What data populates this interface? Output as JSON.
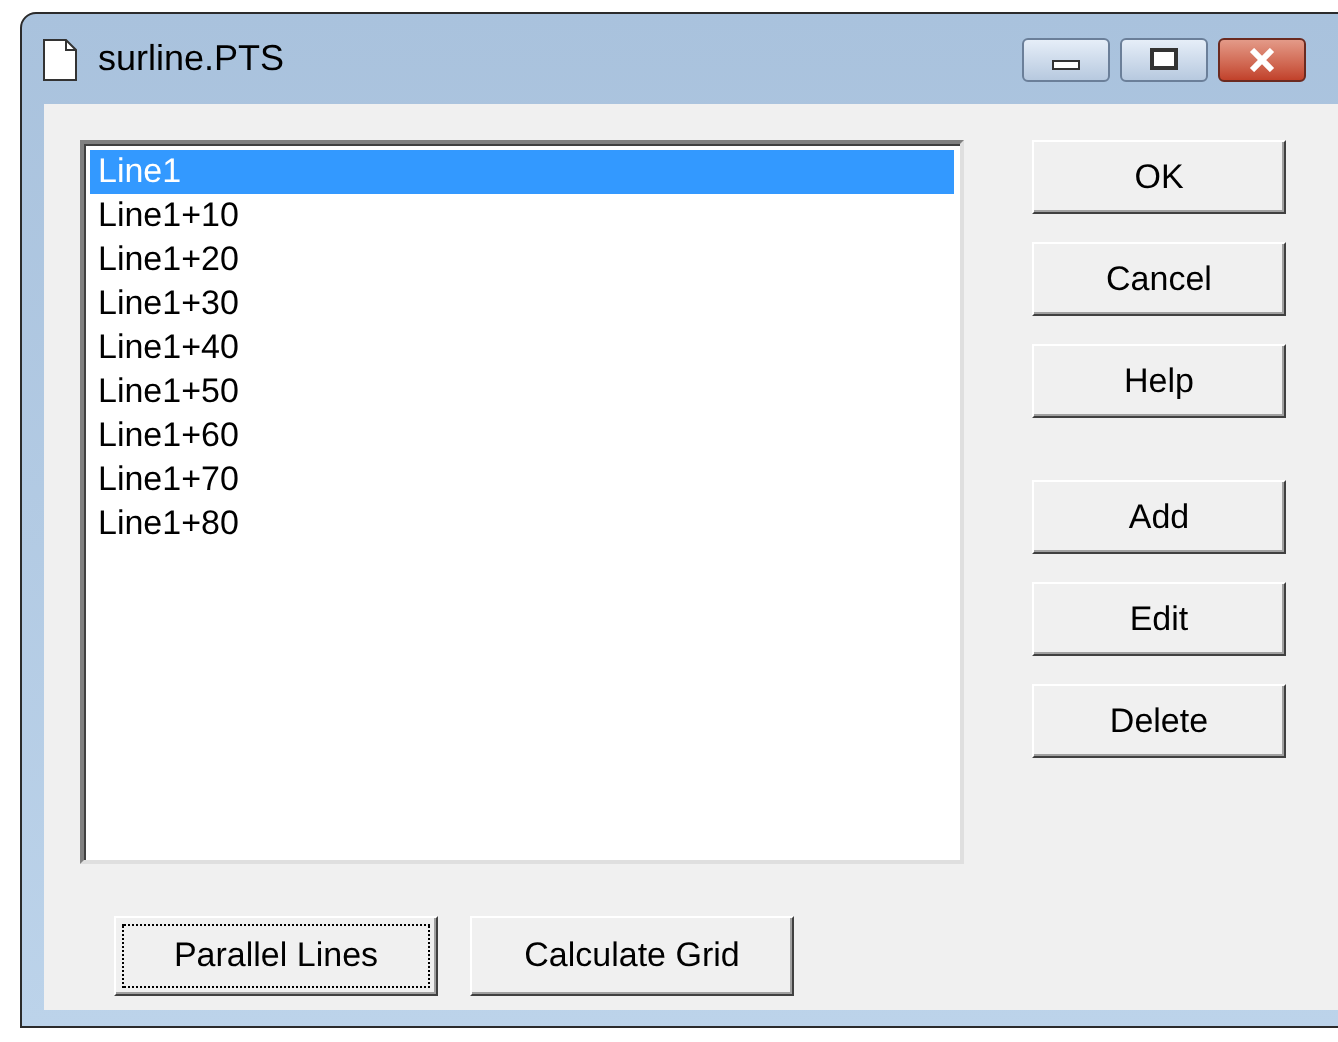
{
  "window": {
    "title": "surline.PTS"
  },
  "list": {
    "items": [
      {
        "label": "Line1",
        "selected": true
      },
      {
        "label": "Line1+10",
        "selected": false
      },
      {
        "label": "Line1+20",
        "selected": false
      },
      {
        "label": "Line1+30",
        "selected": false
      },
      {
        "label": "Line1+40",
        "selected": false
      },
      {
        "label": "Line1+50",
        "selected": false
      },
      {
        "label": "Line1+60",
        "selected": false
      },
      {
        "label": "Line1+70",
        "selected": false
      },
      {
        "label": "Line1+80",
        "selected": false
      }
    ]
  },
  "side_button_groups": [
    {
      "buttons": [
        "OK",
        "Cancel",
        "Help"
      ]
    },
    {
      "buttons": [
        "Add",
        "Edit",
        "Delete"
      ]
    }
  ],
  "bottom_buttons": [
    {
      "label": "Parallel Lines",
      "focused": true
    },
    {
      "label": "Calculate Grid",
      "focused": false
    }
  ]
}
